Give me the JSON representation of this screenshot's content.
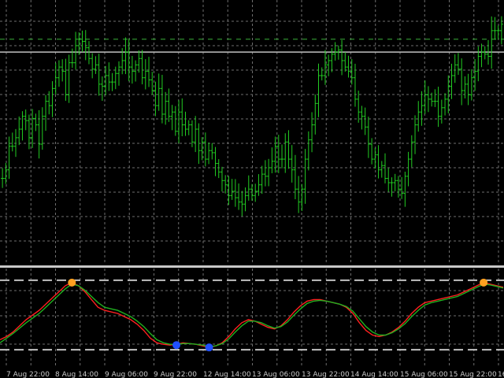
{
  "colors": {
    "background": "#000000",
    "grid": "#6e6e6e",
    "price_bars": "#22cc22",
    "separator": "#c8c8c8",
    "level_line": "#c0c0c0",
    "dashed_level": "#2f8f2f",
    "osc_main": "#ff2020",
    "osc_signal": "#20b020",
    "marker_top": "#ffa020",
    "marker_bottom": "#2050ff",
    "tick_text": "#c8c8c8"
  },
  "chart_data": [
    {
      "type": "bar",
      "panel": "price",
      "series": [
        {
          "name": "",
          "values": [
            0.27,
            0.31,
            0.42,
            0.42,
            0.46,
            0.5,
            0.56,
            0.54,
            0.46,
            0.55,
            0.52,
            0.43,
            0.56,
            0.63,
            0.61,
            0.69,
            0.74,
            0.79,
            0.77,
            0.66,
            0.81,
            0.81,
            0.89,
            0.92,
            0.91,
            0.88,
            0.83,
            0.78,
            0.8,
            0.71,
            0.7,
            0.75,
            0.72,
            0.72,
            0.76,
            0.79,
            0.82,
            0.86,
            0.79,
            0.77,
            0.8,
            0.83,
            0.74,
            0.77,
            0.73,
            0.68,
            0.61,
            0.69,
            0.57,
            0.63,
            0.56,
            0.58,
            0.49,
            0.58,
            0.52,
            0.5,
            0.52,
            0.44,
            0.5,
            0.4,
            0.44,
            0.36,
            0.4,
            0.39,
            0.34,
            0.3,
            0.26,
            0.24,
            0.19,
            0.21,
            0.18,
            0.16,
            0.15,
            0.19,
            0.22,
            0.19,
            0.21,
            0.24,
            0.29,
            0.28,
            0.32,
            0.35,
            0.42,
            0.36,
            0.36,
            0.44,
            0.36,
            0.31,
            0.22,
            0.16,
            0.22,
            0.36,
            0.45,
            0.52,
            0.62,
            0.75,
            0.75,
            0.8,
            0.82,
            0.85,
            0.86,
            0.87,
            0.82,
            0.79,
            0.77,
            0.74,
            0.64,
            0.58,
            0.56,
            0.51,
            0.43,
            0.36,
            0.38,
            0.31,
            0.33,
            0.27,
            0.25,
            0.25,
            0.26,
            0.22,
            0.2,
            0.28,
            0.36,
            0.44,
            0.52,
            0.58,
            0.61,
            0.66,
            0.64,
            0.63,
            0.63,
            0.56,
            0.6,
            0.64,
            0.7,
            0.75,
            0.8,
            0.78,
            0.68,
            0.71,
            0.66,
            0.74,
            0.77,
            0.84,
            0.86,
            0.85,
            0.84,
            0.96,
            0.96,
            0.96,
            0.99
          ]
        }
      ],
      "ylim": [
        0,
        1
      ],
      "grid": true,
      "level_lines": [
        0.92,
        0.86
      ]
    },
    {
      "type": "line",
      "panel": "oscillator",
      "series": [
        {
          "name": "",
          "values": [
            18,
            22,
            28,
            36,
            44,
            50,
            56,
            64,
            72,
            80,
            88,
            92,
            88,
            80,
            70,
            60,
            56,
            54,
            52,
            48,
            44,
            38,
            30,
            20,
            14,
            12,
            11,
            12,
            14,
            13,
            12,
            10,
            8,
            10,
            14,
            22,
            32,
            40,
            44,
            42,
            38,
            34,
            32,
            36,
            44,
            54,
            62,
            68,
            70,
            70,
            68,
            66,
            64,
            60,
            52,
            40,
            30,
            24,
            22,
            24,
            28,
            34,
            42,
            52,
            60,
            66,
            68,
            70,
            72,
            74,
            76,
            80,
            84,
            88,
            92,
            90,
            88,
            86
          ]
        },
        {
          "name": "",
          "values": [
            14,
            20,
            26,
            33,
            40,
            46,
            52,
            60,
            68,
            76,
            84,
            90,
            88,
            82,
            74,
            66,
            60,
            58,
            56,
            52,
            48,
            42,
            35,
            26,
            18,
            14,
            12,
            12,
            13,
            13,
            12,
            11,
            9,
            10,
            13,
            19,
            28,
            36,
            42,
            42,
            40,
            36,
            33,
            35,
            41,
            50,
            58,
            65,
            68,
            69,
            68,
            66,
            64,
            61,
            55,
            45,
            35,
            28,
            24,
            24,
            27,
            32,
            39,
            48,
            56,
            63,
            66,
            68,
            70,
            72,
            74,
            78,
            82,
            86,
            90,
            89,
            87,
            85
          ]
        }
      ],
      "ylim": [
        0,
        100
      ],
      "grid": true,
      "level_lines": [
        95,
        5
      ],
      "markers": [
        {
          "kind": "top",
          "x_index": 11,
          "value": 92
        },
        {
          "kind": "bottom",
          "x_index": 27,
          "value": 11
        },
        {
          "kind": "bottom",
          "x_index": 32,
          "value": 8
        },
        {
          "kind": "top",
          "x_index": 74,
          "value": 92
        }
      ]
    }
  ],
  "x_axis": {
    "labels": [
      "7 Aug 22:00",
      "8 Aug 14:00",
      "9 Aug 06:00",
      "9 Aug 22:00",
      "12 Aug 14:00",
      "13 Aug 06:00",
      "13 Aug 22:00",
      "14 Aug 14:00",
      "15 Aug 06:00",
      "15 Aug 22:00",
      "16"
    ]
  }
}
